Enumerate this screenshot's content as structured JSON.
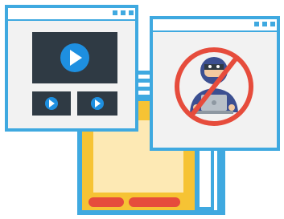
{
  "illustration": {
    "windows": [
      {
        "role": "video-player-window",
        "content": [
          "large-play-icon",
          "small-play-icon",
          "small-play-icon"
        ]
      },
      {
        "role": "blocked-hacker-window",
        "content": [
          "hacker-figure-icon",
          "laptop-icon",
          "prohibition-sign-icon"
        ]
      },
      {
        "role": "stacked-yellow-window",
        "content": [
          "red-button-shape",
          "red-button-shape"
        ]
      }
    ],
    "colors": {
      "window_frame": "#3fa9e0",
      "window_body": "#f2f2f2",
      "video_screen": "#2f3a44",
      "play_button": "#1e8fe0",
      "prohibition": "#e64c3c",
      "hacker_body": "#3b4f91",
      "hacker_skin": "#f2c9a0",
      "yellow_window": "#f6c334",
      "yellow_inner": "#fde9b4",
      "red_button": "#e64c3c"
    }
  }
}
